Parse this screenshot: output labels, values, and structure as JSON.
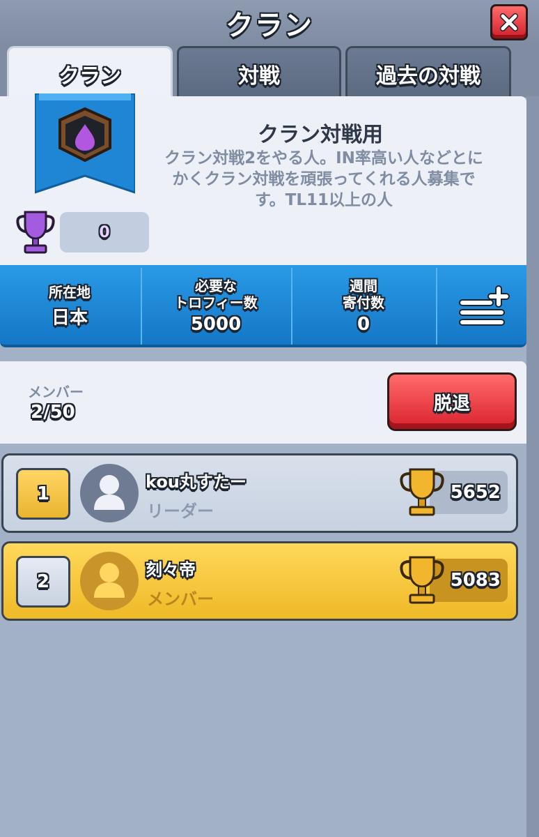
{
  "header": {
    "title": "クラン",
    "close_icon": "close-icon"
  },
  "tabs": [
    {
      "label": "クラン",
      "active": true
    },
    {
      "label": "対戦",
      "active": false
    },
    {
      "label": "過去の対戦",
      "active": false
    }
  ],
  "clan": {
    "name": "クラン対戦用",
    "description": "クラン対戦2をやる人。IN率高い人などとにかくクラン対戦を頑張ってくれる人募集です。TL11以上の人",
    "trophies": "0",
    "badge_icon": "clan-badge-icon"
  },
  "stats": {
    "location_label": "所在地",
    "location_value": "日本",
    "required_label_1": "必要な",
    "required_label_2": "トロフィー数",
    "required_value": "5000",
    "weekly_label_1": "週間",
    "weekly_label_2": "寄付数",
    "weekly_value": "0",
    "menu_icon": "list-add-icon"
  },
  "members": {
    "label": "メンバー",
    "count": "2/50",
    "leave_label": "脱退",
    "list": [
      {
        "rank": "1",
        "name": "kou丸すたー",
        "role": "リーダー",
        "trophies": "5652"
      },
      {
        "rank": "2",
        "name": "刻々帝",
        "role": "メンバー",
        "trophies": "5083"
      }
    ]
  },
  "colors": {
    "accent_blue": "#1a86d6",
    "leave_red": "#d9222d",
    "gold_row": "#efb927"
  }
}
